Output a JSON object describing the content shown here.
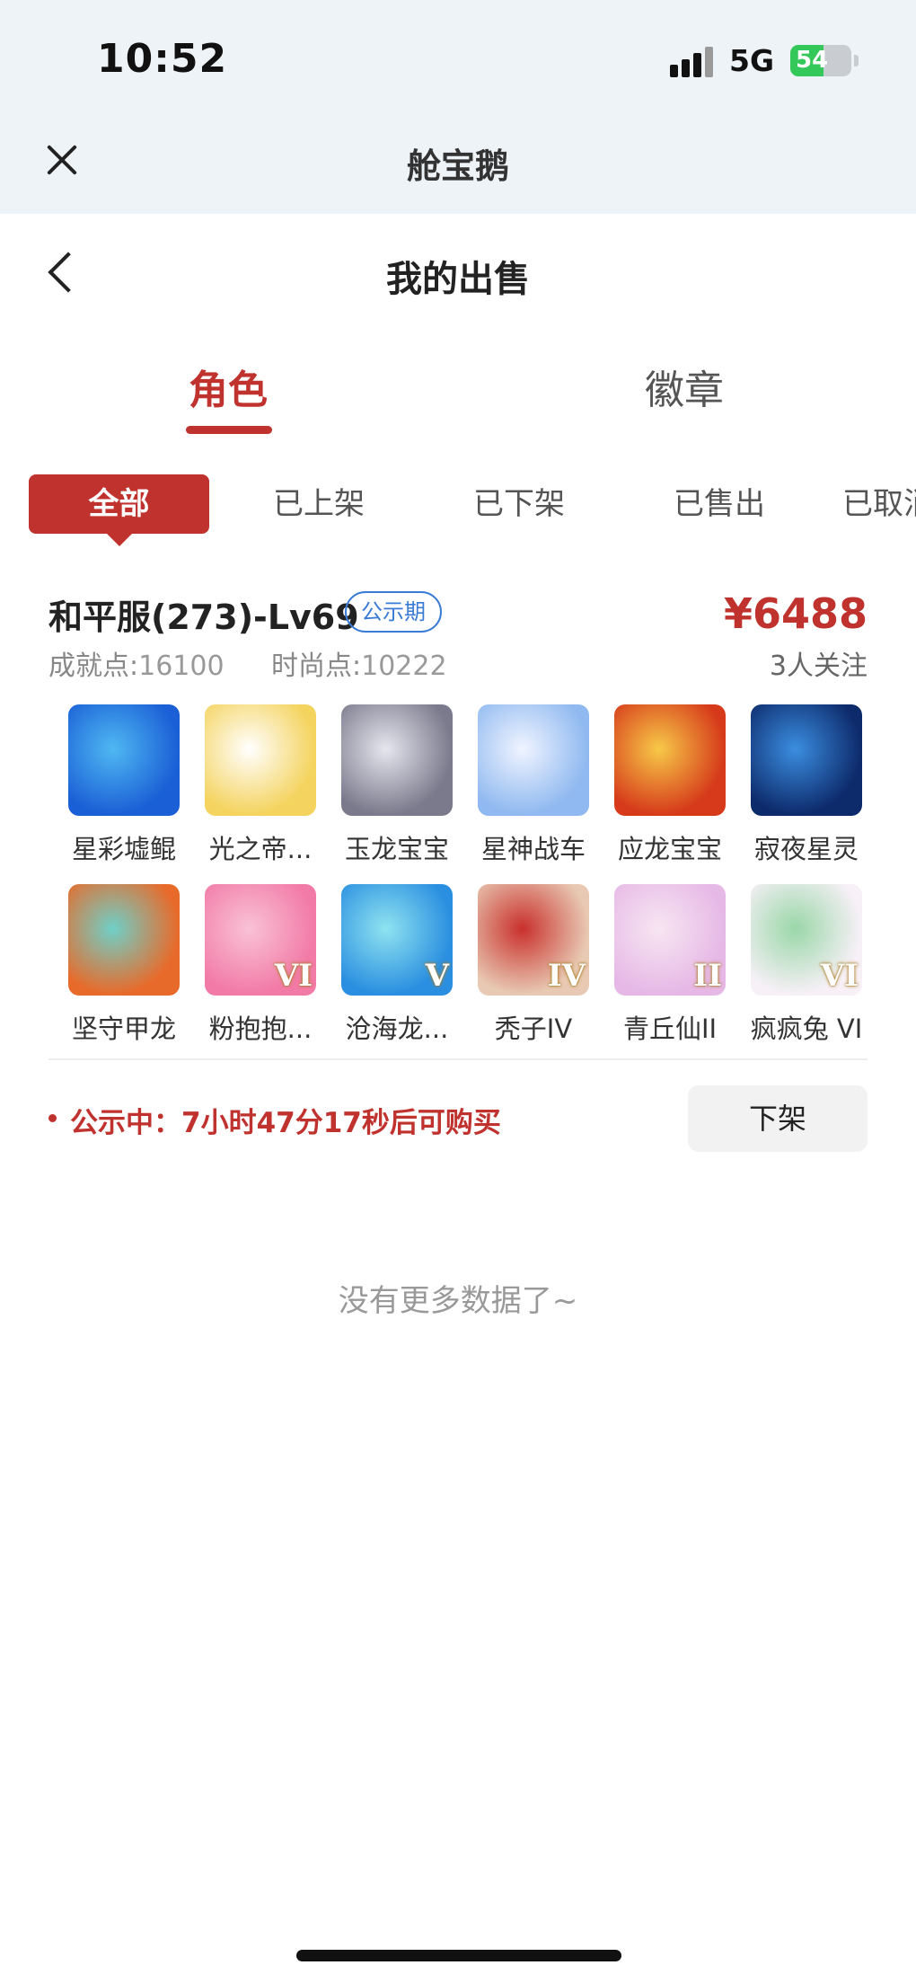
{
  "status_bar": {
    "time": "10:52",
    "network": "5G",
    "battery": "54",
    "battery_level": 0.54
  },
  "app_header": {
    "title": "舱宝鹅",
    "close_icon": "close-icon"
  },
  "page_header": {
    "title": "我的出售",
    "back_icon": "chevron-left-icon"
  },
  "main_tabs": [
    {
      "label": "角色",
      "active": true
    },
    {
      "label": "徽章",
      "active": false
    }
  ],
  "filters": [
    {
      "label": "全部",
      "active": true
    },
    {
      "label": "已上架",
      "active": false
    },
    {
      "label": "已下架",
      "active": false
    },
    {
      "label": "已售出",
      "active": false
    },
    {
      "label": "已取消",
      "active": false
    }
  ],
  "listing": {
    "title": "和平服(273)-Lv69",
    "badge": "公示期",
    "price": "¥6488",
    "achievement_label": "成就点:",
    "achievement_value": "16100",
    "fashion_label": "时尚点:",
    "fashion_value": "10222",
    "followers": "3人关注",
    "pets": [
      {
        "name": "星彩墟鲲",
        "roman": "",
        "colors": [
          "#1a5fd6",
          "#4fb8f2"
        ]
      },
      {
        "name": "光之帝...",
        "roman": "",
        "colors": [
          "#f4d35e",
          "#ffffff"
        ]
      },
      {
        "name": "玉龙宝宝",
        "roman": "",
        "colors": [
          "#7a7a8c",
          "#e6e6ef"
        ]
      },
      {
        "name": "星神战车",
        "roman": "",
        "colors": [
          "#8fb9f0",
          "#f0f4ff"
        ]
      },
      {
        "name": "应龙宝宝",
        "roman": "",
        "colors": [
          "#d63a1a",
          "#f7c948"
        ]
      },
      {
        "name": "寂夜星灵",
        "roman": "",
        "colors": [
          "#0d2a6b",
          "#3b8ee0"
        ]
      },
      {
        "name": "坚守甲龙",
        "roman": "",
        "colors": [
          "#e86a2a",
          "#6fd0c8"
        ]
      },
      {
        "name": "粉抱抱...",
        "roman": "VI",
        "colors": [
          "#f27aa6",
          "#f9c2d6"
        ]
      },
      {
        "name": "沧海龙...",
        "roman": "V",
        "colors": [
          "#2a8fe0",
          "#8fe3f0"
        ]
      },
      {
        "name": "秃子IV",
        "roman": "IV",
        "colors": [
          "#e8c9b3",
          "#c9302c"
        ]
      },
      {
        "name": "青丘仙II",
        "roman": "II",
        "colors": [
          "#e6b8e6",
          "#f7e6f2"
        ]
      },
      {
        "name": "疯疯兔 VI",
        "roman": "VI",
        "colors": [
          "#f7f0f7",
          "#9ad7a8"
        ]
      }
    ]
  },
  "notice": "公示中：7小时47分17秒后可购买",
  "delist_button": "下架",
  "empty_tip": "没有更多数据了~"
}
